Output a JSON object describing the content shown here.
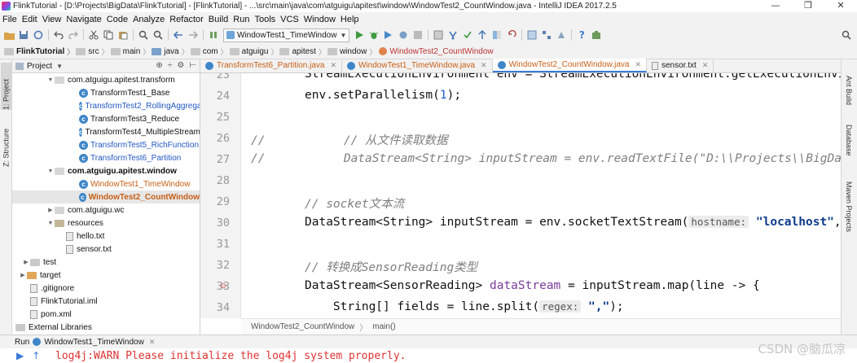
{
  "window": {
    "title": "FlinkTutorial - [D:\\Projects\\BigData\\FlinkTutorial] - [FlinkTutorial] - ...\\src\\main\\java\\com\\atguigu\\apitest\\window\\WindowTest2_CountWindow.java - IntelliJ IDEA 2017.2.5",
    "minimize": "—",
    "maximize": "❐",
    "close": "✕"
  },
  "menu": [
    "File",
    "Edit",
    "View",
    "Navigate",
    "Code",
    "Analyze",
    "Refactor",
    "Build",
    "Run",
    "Tools",
    "VCS",
    "Window",
    "Help"
  ],
  "toolbar": {
    "run_config": "WindowTest1_TimeWindow"
  },
  "breadcrumb": [
    "FlinkTutorial",
    "src",
    "main",
    "java",
    "com",
    "atguigu",
    "apitest",
    "window",
    "WindowTest2_CountWindow"
  ],
  "left_strip": {
    "project_tab": "1: Project",
    "structure_tab": "Z: Structure"
  },
  "project": {
    "header": "Project",
    "tree": [
      {
        "label": "com.atguigu.apitest.transform",
        "kind": "package",
        "arrow": "▼",
        "color": "black"
      },
      {
        "label": "TransformTest1_Base",
        "kind": "class",
        "color": "black"
      },
      {
        "label": "TransformTest2_RollingAggregation",
        "kind": "class",
        "color": "blue"
      },
      {
        "label": "TransformTest3_Reduce",
        "kind": "class",
        "color": "black"
      },
      {
        "label": "TransformTest4_MultipleStreams",
        "kind": "class",
        "color": "black"
      },
      {
        "label": "TransformTest5_RichFunction",
        "kind": "class",
        "color": "blue"
      },
      {
        "label": "TransformTest6_Partition",
        "kind": "class",
        "color": "blue"
      },
      {
        "label": "com.atguigu.apitest.window",
        "kind": "package",
        "arrow": "▼",
        "color": "black"
      },
      {
        "label": "WindowTest1_TimeWindow",
        "kind": "class",
        "color": "orange"
      },
      {
        "label": "WindowTest2_CountWindow",
        "kind": "class",
        "color": "orange",
        "selected": true
      },
      {
        "label": "com.atguigu.wc",
        "kind": "package",
        "arrow": "▶",
        "color": "black"
      },
      {
        "label": "resources",
        "kind": "res",
        "arrow": "▼",
        "color": "black"
      },
      {
        "label": "hello.txt",
        "kind": "text",
        "color": "black"
      },
      {
        "label": "sensor.txt",
        "kind": "text",
        "color": "black"
      },
      {
        "label": "test",
        "kind": "folder",
        "arrow": "▶",
        "color": "black"
      },
      {
        "label": "target",
        "kind": "folder-orange",
        "arrow": "▶",
        "color": "black"
      },
      {
        "label": ".gitignore",
        "kind": "text",
        "color": "black"
      },
      {
        "label": "FlinkTutorial.iml",
        "kind": "text",
        "color": "black"
      },
      {
        "label": "pom.xml",
        "kind": "text",
        "color": "black"
      },
      {
        "label": "External Libraries",
        "kind": "lib",
        "color": "black"
      }
    ]
  },
  "tabs": [
    {
      "label": "TransformTest6_Partition.java",
      "color": "orange"
    },
    {
      "label": "WindowTest1_TimeWindow.java",
      "color": "orange"
    },
    {
      "label": "WindowTest2_CountWindow.java",
      "color": "orange",
      "active": true
    },
    {
      "label": "sensor.txt",
      "color": "black",
      "text": true
    }
  ],
  "right_strip": [
    "Ant Build",
    "Database",
    "Maven Projects"
  ],
  "code": {
    "line23": {
      "num": "23",
      "text": "StreamExecutionEnvironment env = StreamExecutionEnvironment.getExecutionEnvironment();"
    },
    "line24": {
      "num": "24",
      "a": "env.setParallelism(",
      "n": "1",
      "b": ");"
    },
    "line25": {
      "num": "25"
    },
    "line26": {
      "num": "26",
      "a": "//",
      "b": "      // 从文件读取数据"
    },
    "line27": {
      "num": "27",
      "a": "//",
      "b": "      DataStream<String> inputStream = env.readTextFile(\"D:\\\\Projects\\\\BigData\\\\Fl"
    },
    "line28": {
      "num": "28"
    },
    "line29": {
      "num": "29",
      "text": "// socket文本流"
    },
    "line30": {
      "num": "30",
      "a": "DataStream<String> inputStream = env.socketTextStream(",
      "hint": "hostname:",
      "s": "\"localhost\"",
      "b": ",  p"
    },
    "line31": {
      "num": "31"
    },
    "line32": {
      "num": "32",
      "text": "// 转换成SensorReading类型"
    },
    "line33": {
      "num": "33",
      "a": "DataStream<SensorReading> ",
      "f": "dataStream",
      "b": " = inputStream.map(line -> {"
    },
    "line34": {
      "num": "34",
      "a": "    String[] fields = line.split(",
      "hint": "regex:",
      "s": "\",\"",
      "b": ");"
    }
  },
  "editor_crumb": [
    "WindowTest2_CountWindow",
    "main()"
  ],
  "run": {
    "label": "Run",
    "tab": "WindowTest1_TimeWindow"
  },
  "console": {
    "message": "log4j:WARN Please initialize the log4j system properly."
  },
  "watermark": "CSDN @脑瓜凉"
}
